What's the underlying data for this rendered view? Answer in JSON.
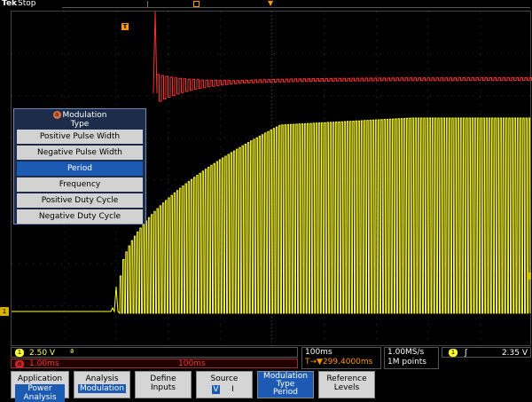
{
  "top": {
    "brand": "Tek",
    "state": "Stop",
    "trigger_marker": "T"
  },
  "screen": {
    "ch1_marker": "1",
    "modulation_menu": {
      "badge": "a",
      "title_line1": "Modulation",
      "title_line2": "Type",
      "items": [
        {
          "label": "Positive Pulse Width",
          "selected": false
        },
        {
          "label": "Negative Pulse Width",
          "selected": false
        },
        {
          "label": "Period",
          "selected": true
        },
        {
          "label": "Frequency",
          "selected": false
        },
        {
          "label": "Positive Duty Cycle",
          "selected": false
        },
        {
          "label": "Negative Duty Cycle",
          "selected": false
        }
      ]
    }
  },
  "status": {
    "ch1_badge": "1",
    "ch1_scale": "2.50 V",
    "ch1_bw_symbol": "ª",
    "math_badge": "a",
    "math_scale": "1.00ms",
    "math_timebase": "100ms",
    "timebase": "100ms",
    "trigger_position": "T→▼299.4000ms",
    "sample_rate": "1.00MS/s",
    "record_length": "1M points",
    "trig_badge": "1",
    "trig_slope": "ʃ",
    "trig_level": "2.35 V"
  },
  "buttons": [
    {
      "line1": "Application",
      "line2": "Power Analysis"
    },
    {
      "line1": "Analysis",
      "line2": "Modulation"
    },
    {
      "line1": "Define",
      "line2": "Inputs"
    },
    {
      "line1": "Source",
      "v": "V",
      "i": "I"
    },
    {
      "line1": "Modulation",
      "line2": "Type",
      "line3": "Period"
    },
    {
      "line1": "Reference",
      "line2": "Levels"
    }
  ],
  "colors": {
    "ch1": "#ffff33",
    "math": "#ff3030",
    "menu_selected": "#1d5ab4"
  }
}
